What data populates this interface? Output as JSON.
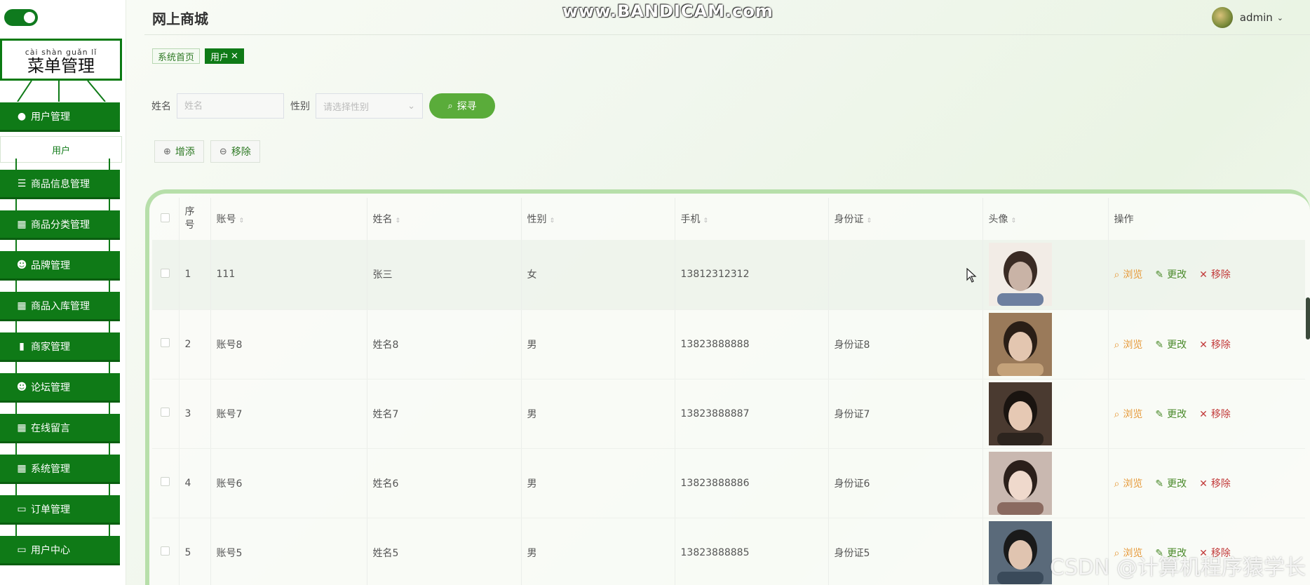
{
  "app": {
    "title": "网上商城"
  },
  "screen_recorder_watermark": "www.BANDICAM.com",
  "bottom_watermark": "CSDN @计算机程序猿学长",
  "header": {
    "username": "admin",
    "caret": "⌄"
  },
  "sidebar": {
    "title_pinyin": "cài shàn guǎn lǐ",
    "title": "菜单管理",
    "items": [
      {
        "label": "用户管理",
        "icon": "bulb-icon",
        "glyph": "●",
        "sub": "用户"
      },
      {
        "label": "商品信息管理",
        "icon": "list-icon",
        "glyph": "☰"
      },
      {
        "label": "商品分类管理",
        "icon": "grid-icon",
        "glyph": "▦"
      },
      {
        "label": "品牌管理",
        "icon": "user-icon",
        "glyph": "☻"
      },
      {
        "label": "商品入库管理",
        "icon": "grid-icon",
        "glyph": "▦"
      },
      {
        "label": "商家管理",
        "icon": "bar-chart-icon",
        "glyph": "▮"
      },
      {
        "label": "论坛管理",
        "icon": "person-icon",
        "glyph": "☻"
      },
      {
        "label": "在线留言",
        "icon": "table-icon",
        "glyph": "▦"
      },
      {
        "label": "系统管理",
        "icon": "grid-icon",
        "glyph": "▦"
      },
      {
        "label": "订单管理",
        "icon": "monitor-icon",
        "glyph": "▭"
      },
      {
        "label": "用户中心",
        "icon": "card-icon",
        "glyph": "▭"
      }
    ]
  },
  "breadcrumb": [
    {
      "label": "系统首页"
    },
    {
      "label": "用户",
      "active": true,
      "close": "✕"
    }
  ],
  "search": {
    "name_label": "姓名",
    "name_placeholder": "姓名",
    "gender_label": "性别",
    "gender_placeholder": "请选择性别",
    "button_label": "探寻"
  },
  "actions": {
    "add": "增添",
    "remove": "移除"
  },
  "table": {
    "columns": [
      "序号",
      "账号",
      "姓名",
      "性别",
      "手机",
      "身份证",
      "头像",
      "操作"
    ],
    "row_ops": {
      "view": "浏览",
      "edit": "更改",
      "delete": "移除"
    },
    "rows": [
      {
        "no": "1",
        "account": "111",
        "name": "张三",
        "gender": "女",
        "phone": "13812312312",
        "id_card": ""
      },
      {
        "no": "2",
        "account": "账号8",
        "name": "姓名8",
        "gender": "男",
        "phone": "13823888888",
        "id_card": "身份证8"
      },
      {
        "no": "3",
        "account": "账号7",
        "name": "姓名7",
        "gender": "男",
        "phone": "13823888887",
        "id_card": "身份证7"
      },
      {
        "no": "4",
        "account": "账号6",
        "name": "姓名6",
        "gender": "男",
        "phone": "13823888886",
        "id_card": "身份证6"
      },
      {
        "no": "5",
        "account": "账号5",
        "name": "姓名5",
        "gender": "男",
        "phone": "13823888885",
        "id_card": "身份证5"
      }
    ]
  },
  "colors": {
    "primary": "#0f7a17",
    "accent": "#5aac3a",
    "view": "#e69a3a",
    "edit": "#4a8a2a",
    "delete": "#c23b3b"
  }
}
